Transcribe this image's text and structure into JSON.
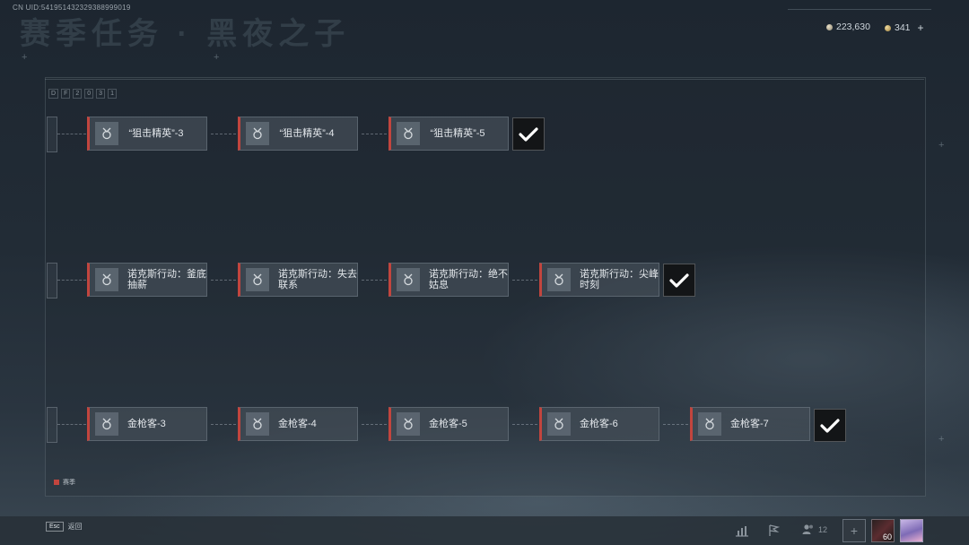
{
  "header": {
    "uid": "CN UID:541951432329388999019",
    "title": "赛季任务 · 黑夜之子",
    "currency_primary": "223,630",
    "currency_secondary": "341",
    "add_symbol": "+"
  },
  "code_panel": {
    "chars": [
      "D",
      "F",
      "2",
      "0",
      "3",
      "1"
    ]
  },
  "rows": [
    {
      "nodes": [
        {
          "label": "“狙击精英”-3"
        },
        {
          "label": "“狙击精英”-4"
        },
        {
          "label": "“狙击精英”-5"
        }
      ],
      "completed": true
    },
    {
      "nodes": [
        {
          "label": "诺克斯行动：釜底抽薪"
        },
        {
          "label": "诺克斯行动：失去联系"
        },
        {
          "label": "诺克斯行动：绝不姑息"
        },
        {
          "label": "诺克斯行动：尖峰时刻"
        }
      ],
      "completed": true
    },
    {
      "nodes": [
        {
          "label": "金枪客-3"
        },
        {
          "label": "金枪客-4"
        },
        {
          "label": "金枪客-5"
        },
        {
          "label": "金枪客-6"
        },
        {
          "label": "金枪客-7"
        }
      ],
      "completed": true
    }
  ],
  "legend": {
    "label": "赛季",
    "color": "#c2453e"
  },
  "footer": {
    "esc_key": "Esc",
    "back_label": "返回",
    "friends_count": "12",
    "empty_slot": "+",
    "level": "60"
  }
}
